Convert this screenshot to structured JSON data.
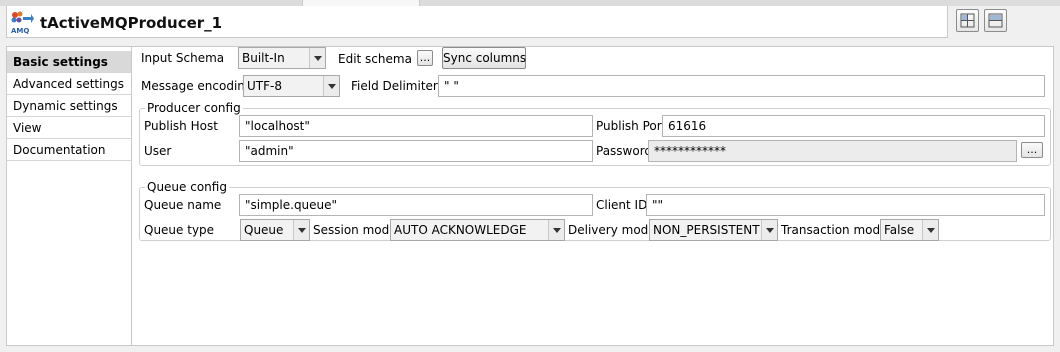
{
  "header": {
    "title": "tActiveMQProducer_1",
    "logo_text": "AMQ"
  },
  "nav": {
    "items": [
      {
        "label": "Basic settings",
        "active": true
      },
      {
        "label": "Advanced settings"
      },
      {
        "label": "Dynamic settings"
      },
      {
        "label": "View"
      },
      {
        "label": "Documentation"
      }
    ]
  },
  "basic": {
    "input_schema_label": "Input Schema",
    "input_schema_value": "Built-In",
    "edit_schema_label": "Edit schema",
    "edit_schema_button": "...",
    "sync_columns_button": "Sync columns",
    "message_encoding_label": "Message encoding",
    "message_encoding_value": "UTF-8",
    "field_delimiter_label": "Field Delimiter",
    "field_delimiter_value": "\" \""
  },
  "producer": {
    "group_title": "Producer config",
    "publish_host_label": "Publish Host",
    "publish_host_value": "\"localhost\"",
    "publish_port_label": "Publish Port",
    "publish_port_value": "61616",
    "user_label": "User",
    "user_value": "\"admin\"",
    "password_label": "Password",
    "password_value": "************",
    "password_button": "..."
  },
  "queue": {
    "group_title": "Queue config",
    "queue_name_label": "Queue name",
    "queue_name_value": "\"simple.queue\"",
    "client_id_label": "Client ID",
    "client_id_value": "\"\"",
    "queue_type_label": "Queue type",
    "queue_type_value": "Queue",
    "session_mode_label": "Session mode",
    "session_mode_value": "AUTO ACKNOWLEDGE",
    "delivery_mode_label": "Delivery mode",
    "delivery_mode_value": "NON_PERSISTENT",
    "transaction_mode_label": "Transaction mode",
    "transaction_mode_value": "False"
  }
}
